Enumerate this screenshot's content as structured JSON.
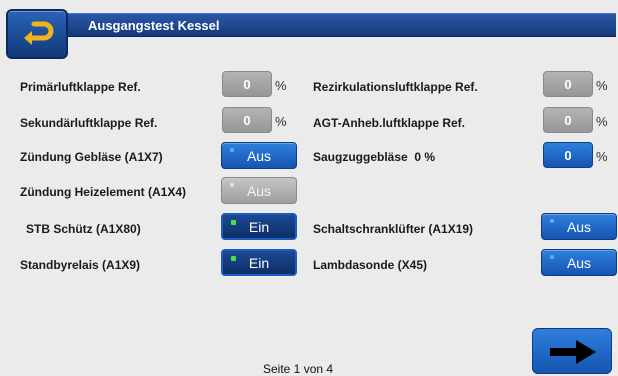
{
  "header": {
    "title": "Ausgangstest Kessel"
  },
  "icons": {
    "back": "return-arrow-icon",
    "next": "arrow-right-icon"
  },
  "colors": {
    "title_bar": "#1f4a94",
    "button_blue": "#1f6bcc",
    "button_active_dark": "#143c7c",
    "led_on": "#45e04a",
    "field_grey": "#a6a6a6",
    "background": "#ebebeb"
  },
  "left": {
    "primaer": {
      "label": "Primärluftklappe Ref.",
      "value": "0",
      "unit": "%"
    },
    "sekundaer": {
      "label": "Sekundärluftklappe Ref.",
      "value": "0",
      "unit": "%"
    },
    "zuend_geblaese": {
      "label": "Zündung Gebläse (A1X7)",
      "button": "Aus"
    },
    "zuend_heiz": {
      "label": "Zündung Heizelement (A1X4)",
      "button": "Aus",
      "disabled": true
    },
    "stb": {
      "label": "STB Schütz (A1X80)",
      "button": "Ein",
      "on": true
    },
    "standby": {
      "label": "Standbyrelais (A1X9)",
      "button": "Ein",
      "on": true
    }
  },
  "right": {
    "rezirk": {
      "label": "Rezirkulationsluftklappe Ref.",
      "value": "0",
      "unit": "%"
    },
    "agt": {
      "label": "AGT-Anheb.luftklappe Ref.",
      "value": "0",
      "unit": "%"
    },
    "saugzug": {
      "label": "Saugzuggebläse  0 %",
      "value": "0",
      "unit": "%"
    },
    "schalt": {
      "label": "Schaltschranklüfter (A1X19)",
      "button": "Aus"
    },
    "lambda": {
      "label": "Lambdasonde (X45)",
      "button": "Aus"
    }
  },
  "footer": {
    "page": "Seite 1 von 4"
  }
}
